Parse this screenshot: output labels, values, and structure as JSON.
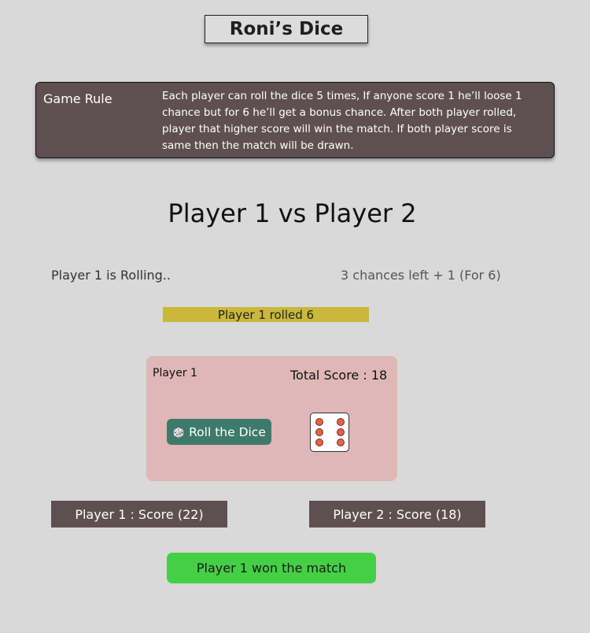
{
  "header": {
    "title": "Roni’s Dice"
  },
  "rules": {
    "label": "Game Rule",
    "text": "Each player can roll the dice 5 times, If anyone score 1 he’ll loose 1 chance but for 6 he’ll get a bonus chance. After both player rolled, player that higher score will win the match. If both player score is same then the match will be drawn."
  },
  "match": {
    "title": "Player 1 vs Player 2"
  },
  "status": {
    "rolling": "Player 1 is Rolling..",
    "chances": "3 chances left + 1 (For 6)",
    "last_roll": "Player 1 rolled 6"
  },
  "card": {
    "player": "Player 1",
    "total_score": "Total Score : 18",
    "roll_button": "Roll the Dice",
    "die_face": 6
  },
  "scores": {
    "player1": "Player 1 :  Score (22)",
    "player2": "Player 2 : Score (18)"
  },
  "result": {
    "text": "Player 1 won the match"
  },
  "colors": {
    "background": "#d9d9d9",
    "dark_panel": "#5e5052",
    "banner": "#c9b83b",
    "card": "#deb7b6",
    "button": "#3e7a6b",
    "pip": "#e2624b",
    "winner": "#45cf45"
  }
}
